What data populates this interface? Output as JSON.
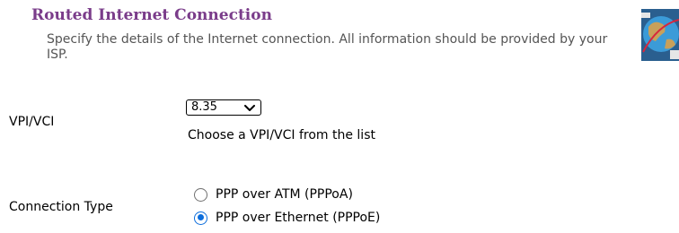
{
  "header": {
    "title": "Routed Internet Connection",
    "description": "Specify the details of the Internet connection. All information should be provided by your ISP.",
    "icon": "globe-network-icon"
  },
  "vpi_vci": {
    "label": "VPI/VCI",
    "selected": "8.35",
    "hint": "Choose a VPI/VCI from the list"
  },
  "connection_type": {
    "label": "Connection Type",
    "options": [
      {
        "label": "PPP over ATM (PPPoA)",
        "checked": false
      },
      {
        "label": "PPP over Ethernet (PPPoE)",
        "checked": true
      }
    ]
  },
  "colors": {
    "title": "#7a3c8a",
    "description": "#555555",
    "radio_accent": "#0b6ddc"
  }
}
